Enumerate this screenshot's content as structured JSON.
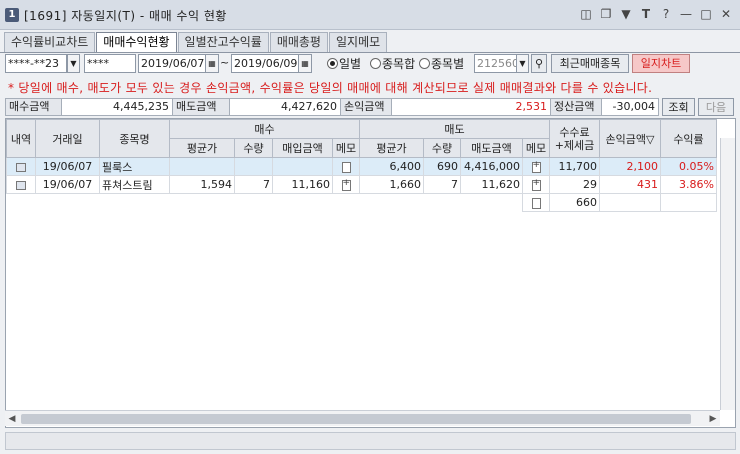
{
  "window": {
    "badge": "1",
    "title": "[1691] 자동일지(T) - 매매 수익 현황"
  },
  "tabs": [
    "수익률비교차트",
    "매매수익현황",
    "일별잔고수익률",
    "매매총평",
    "일지메모"
  ],
  "toolbar": {
    "account": "****-**23",
    "password": "****",
    "date_from": "2019/06/07",
    "date_sep": "~",
    "date_to": "2019/06/09",
    "radio_daily": "일별",
    "radio_stock_sum": "종목합",
    "radio_by_stock": "종목별",
    "stock_code": "212560",
    "recent_btn": "최근매매종목",
    "chart_btn": "일지차트"
  },
  "notice": "* 당일에 매수, 매도가 모두 있는 경우 손익금액, 수익률은 당일의 매매에 대해 계산되므로 실제 매매결과와 다를 수 있습니다.",
  "summary": {
    "buy_label": "매수금액",
    "buy_value": "4,445,235",
    "sell_label": "매도금액",
    "sell_value": "4,427,620",
    "pnl_label": "손익금액",
    "pnl_value": "2,531",
    "settle_label": "정산금액",
    "settle_value": "-30,004",
    "query_btn": "조회",
    "next_btn": "다음"
  },
  "grid": {
    "headers": {
      "detail": "내역",
      "date": "거래일",
      "name": "종목명",
      "buy_group": "매수",
      "sell_group": "매도",
      "fee": "수수료\n+제세금",
      "pnl": "손익금액",
      "pnl_sort": "▽",
      "rate": "수익률",
      "avg": "평균가",
      "qty": "수량",
      "buy_amt": "매입금액",
      "memo": "메모",
      "sell_avg": "평균가",
      "sell_qty": "수량",
      "sell_amt": "매도금액",
      "sell_memo": "메모"
    },
    "rows": [
      {
        "date": "19/06/07",
        "name": "필룩스",
        "buy_avg": "",
        "buy_qty": "",
        "buy_amt": "",
        "sell_avg": "6,400",
        "sell_qty": "690",
        "sell_amt": "4,416,000",
        "fee": "11,700",
        "pnl": "2,100",
        "rate": "0.05%"
      },
      {
        "date": "19/06/07",
        "name": "퓨쳐스트림",
        "buy_avg": "1,594",
        "buy_qty": "7",
        "buy_amt": "11,160",
        "sell_avg": "1,660",
        "sell_qty": "7",
        "sell_amt": "11,620",
        "fee": "29",
        "pnl": "431",
        "rate": "3.86%"
      }
    ],
    "total_fee": "660"
  },
  "icons": {
    "calendar": "calendar-icon",
    "search": "search-icon",
    "dropdown": "chevron-down-icon",
    "memo": "memo-icon",
    "row": "row-detail-icon"
  }
}
